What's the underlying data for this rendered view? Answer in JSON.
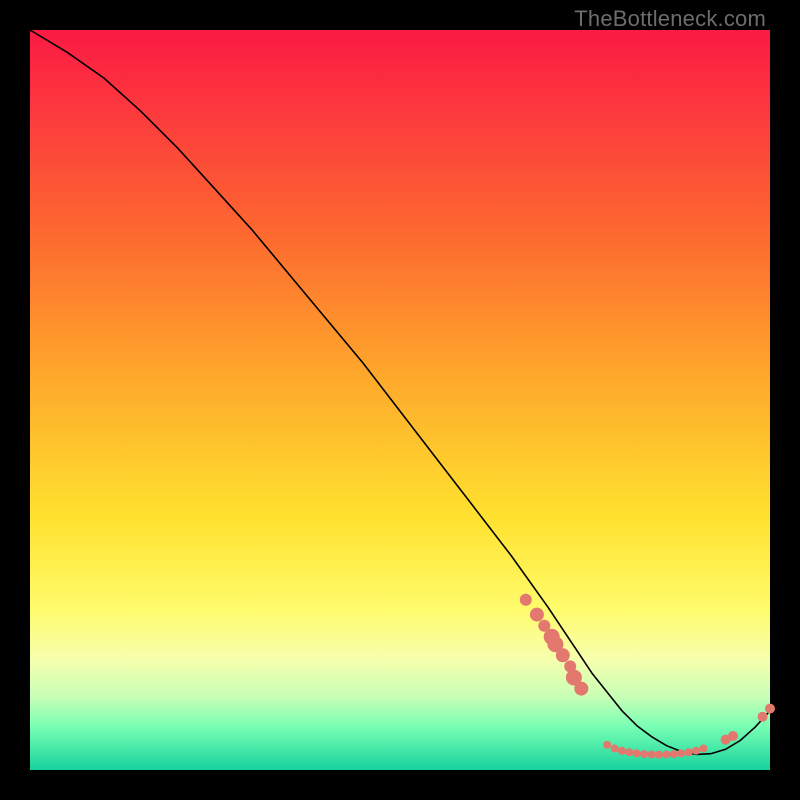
{
  "watermark": "TheBottleneck.com",
  "chart_data": {
    "type": "line",
    "title": "",
    "xlabel": "",
    "ylabel": "",
    "xlim": [
      0,
      100
    ],
    "ylim": [
      0,
      100
    ],
    "grid": false,
    "legend": false,
    "curve": {
      "name": "bottleneck-curve",
      "x": [
        0,
        5,
        10,
        15,
        20,
        25,
        30,
        35,
        40,
        45,
        50,
        55,
        60,
        65,
        70,
        72,
        74,
        76,
        78,
        80,
        82,
        84,
        86,
        88,
        90,
        92,
        94,
        96,
        98,
        100
      ],
      "y": [
        100,
        97,
        93.5,
        89,
        84,
        78.5,
        73,
        67,
        61,
        55,
        48.5,
        42,
        35.5,
        29,
        22,
        19,
        16,
        13,
        10.5,
        8,
        6,
        4.5,
        3.3,
        2.5,
        2.1,
        2.2,
        2.8,
        4,
        5.8,
        8
      ]
    },
    "series": [
      {
        "name": "cluster-mid-left",
        "type": "scatter",
        "x": [
          67,
          68.5,
          69.5,
          70.5,
          71,
          72,
          73
        ],
        "y": [
          23,
          21,
          19.5,
          18,
          17,
          15.5,
          14
        ],
        "r": [
          6,
          7,
          6,
          8,
          8,
          7,
          6
        ]
      },
      {
        "name": "cluster-mid-right",
        "type": "scatter",
        "x": [
          73.5,
          74.5
        ],
        "y": [
          12.5,
          11
        ],
        "r": [
          8,
          7
        ]
      },
      {
        "name": "valley-band",
        "type": "scatter",
        "x": [
          78,
          79,
          80,
          81,
          82,
          83,
          84,
          85,
          86,
          87,
          88,
          89,
          90,
          91
        ],
        "y": [
          3.4,
          2.9,
          2.6,
          2.4,
          2.25,
          2.15,
          2.1,
          2.08,
          2.1,
          2.15,
          2.25,
          2.4,
          2.6,
          2.9
        ],
        "r": [
          4,
          4,
          4,
          4,
          4,
          4,
          4,
          4,
          4,
          4,
          4,
          4,
          4,
          4
        ]
      },
      {
        "name": "valley-band-text",
        "type": "text-marker",
        "x": 84.5,
        "y": 3.2,
        "text": ""
      },
      {
        "name": "right-dots-lower",
        "type": "scatter",
        "x": [
          94,
          95
        ],
        "y": [
          4.1,
          4.6
        ],
        "r": [
          5,
          5
        ]
      },
      {
        "name": "right-dots-upper",
        "type": "scatter",
        "x": [
          99,
          100
        ],
        "y": [
          7.2,
          8.3
        ],
        "r": [
          5,
          5
        ]
      }
    ]
  }
}
